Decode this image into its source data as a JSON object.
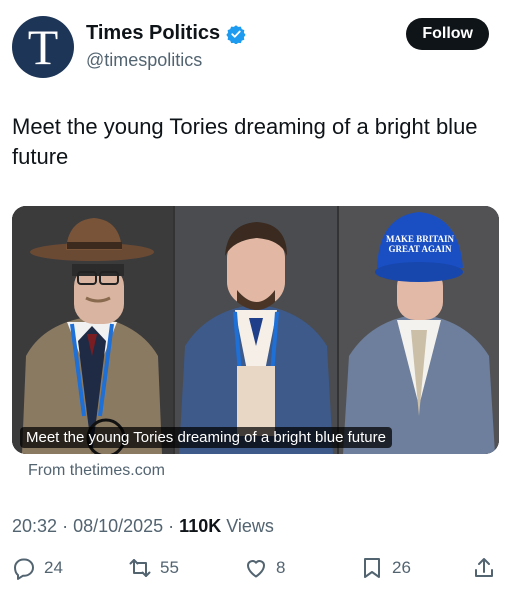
{
  "account": {
    "display_name": "Times Politics",
    "handle": "@timespolitics",
    "avatar_letter": "T",
    "verified_icon": "verified-badge-icon",
    "brand_color": "#1d9bf0"
  },
  "follow_label": "Follow",
  "tweet_text": "Meet the young Tories dreaming of a bright blue future",
  "media": {
    "caption": "Meet the young Tories dreaming of a bright blue future",
    "cap_text_line1": "MAKE BRITAIN",
    "cap_text_line2": "GREAT AGAIN"
  },
  "source": "From thetimes.com",
  "meta": {
    "time": "20:32",
    "date": "08/10/2025",
    "views_count": "110K",
    "views_label": "Views"
  },
  "actions": {
    "replies": "24",
    "retweets": "55",
    "likes": "8",
    "bookmarks": "26"
  }
}
